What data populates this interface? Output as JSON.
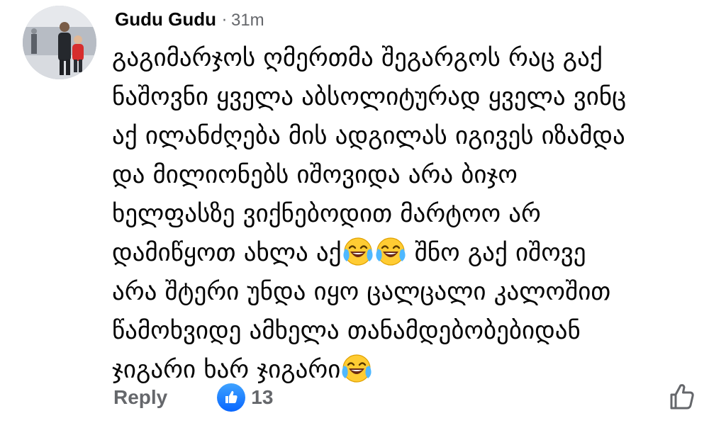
{
  "comment": {
    "author": "Gudu Gudu",
    "separator": "·",
    "time": "31m",
    "lines": [
      "გაგიმარჯოს ღმერთმა შეგარგოს რაც გაქ",
      "ნაშოვნი ყველა აბსოლიტურად ყველა ვინც",
      "აქ ილანძღება მის ადგილას იგივეს იზამდა",
      "და მილიონებს იშოვიდა არა ბიჯო",
      "ხელფასზე ვიქნებოდით მარტოო არ",
      "დამიწყოთ ახლა აქ",
      "შნო გაქ იშოვე",
      "არა შტერი უნდა იყო ცალცალი კალოშით",
      "წამოხვიდე ამხელა თანამდებობებიდან",
      "ჯიგარი ხარ ჯიგარი"
    ]
  },
  "actions": {
    "reply_label": "Reply",
    "reaction_count": "13"
  },
  "icons": {
    "avatar": "profile-photo",
    "emoji": "face-with-tears-of-joy-icon",
    "reaction": "like-reaction-icon",
    "like_button": "thumbs-up-outline-icon"
  },
  "colors": {
    "text": "#050505",
    "meta": "#65676b",
    "like_blue": "#0866ff",
    "background": "#ffffff"
  }
}
